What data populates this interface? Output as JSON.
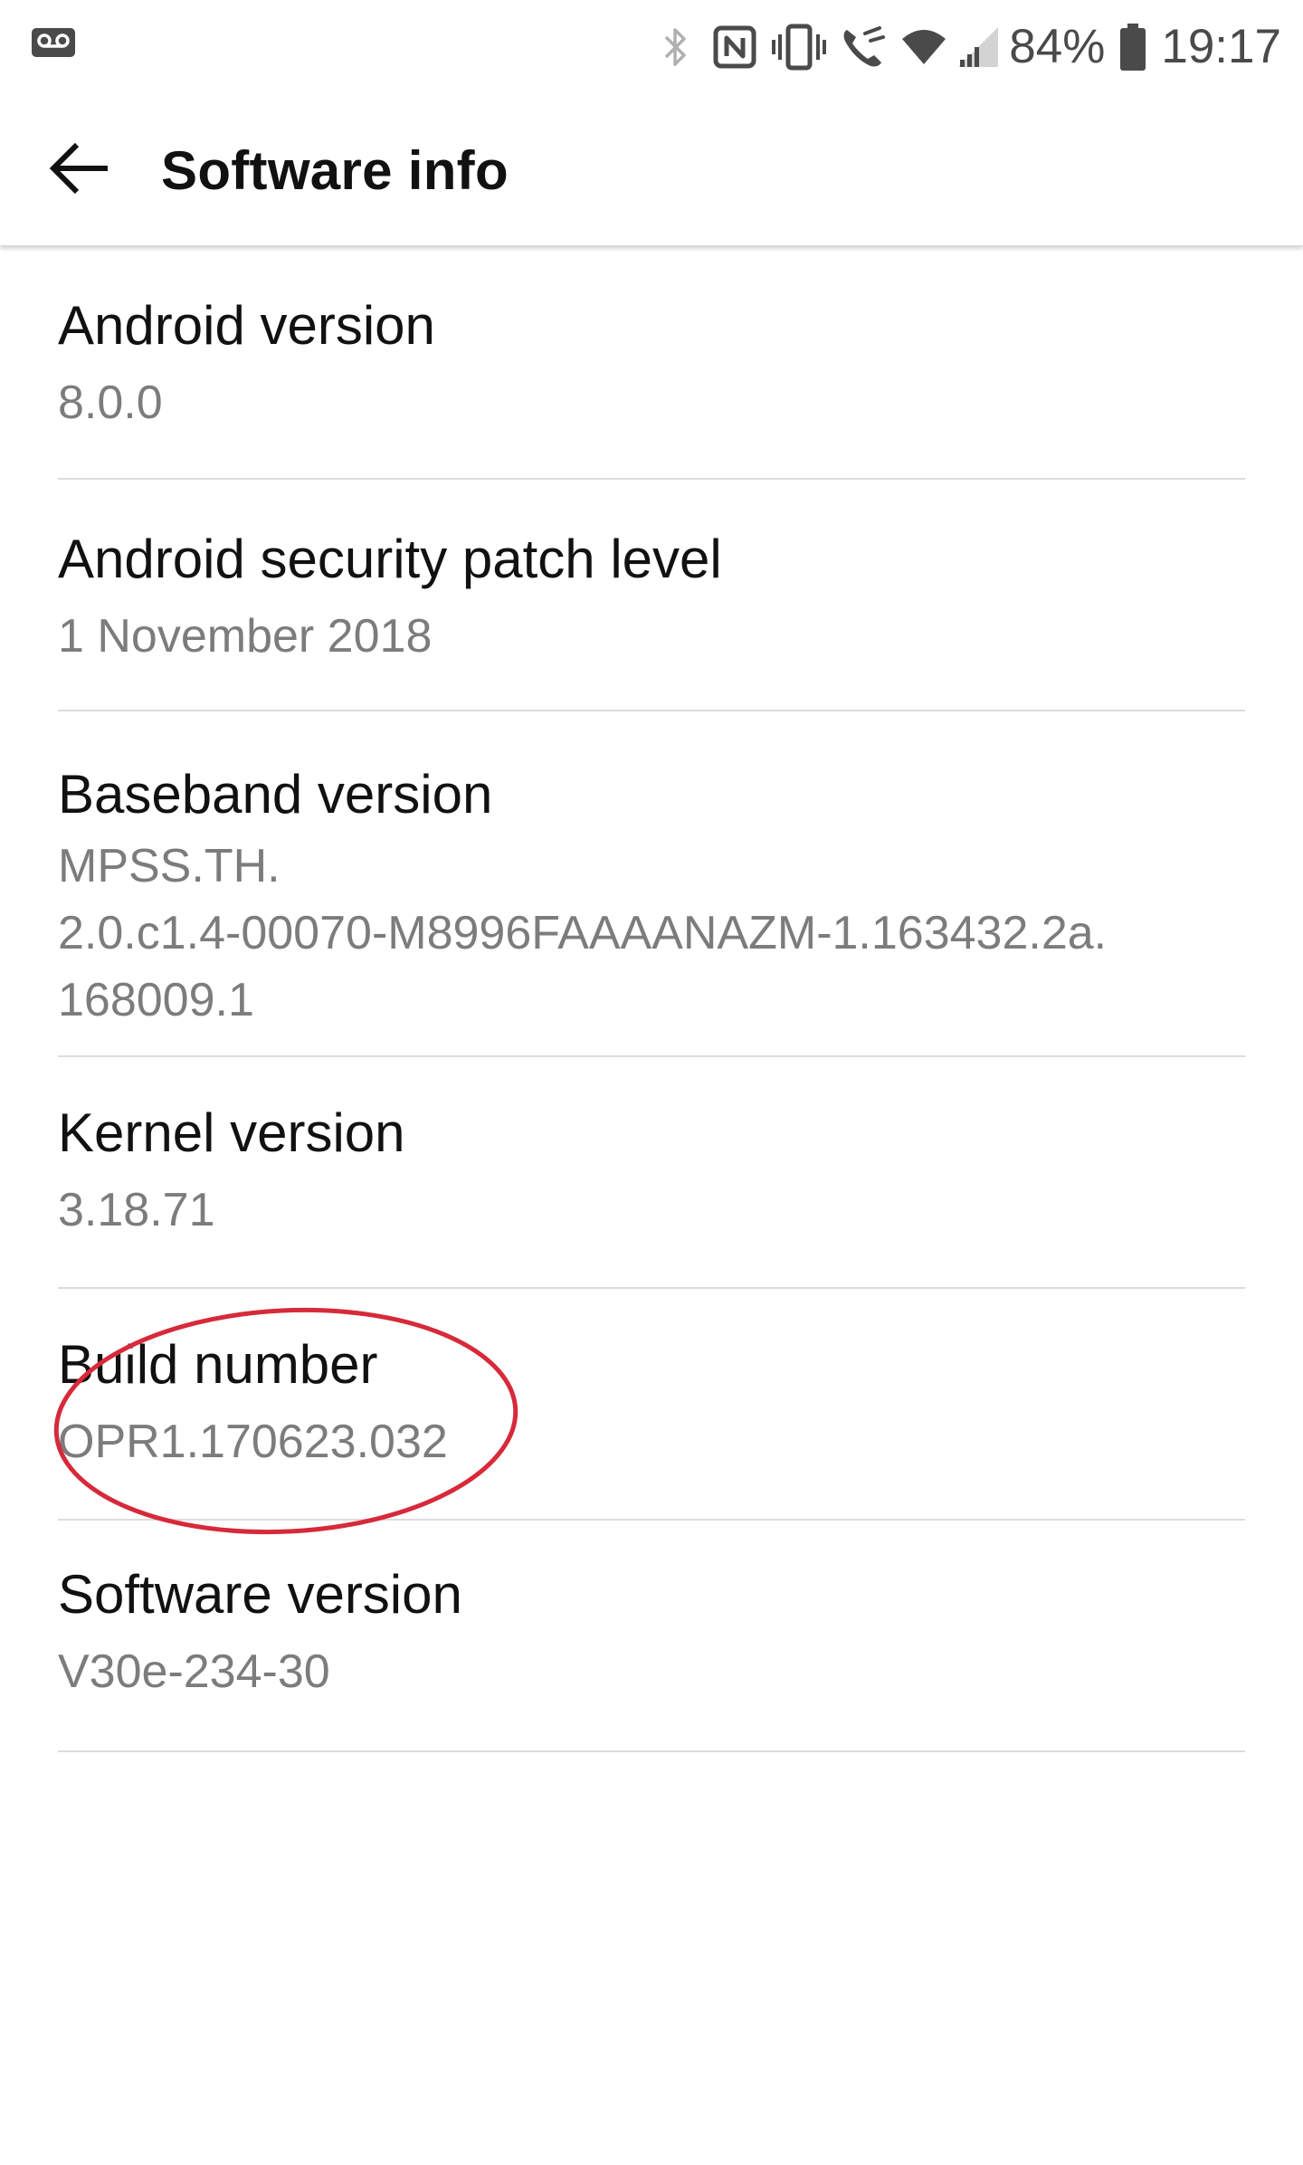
{
  "status_bar": {
    "left_icons": [
      "voicemail-icon"
    ],
    "right_icons": [
      "bluetooth-icon",
      "nfc-icon",
      "vibrate-icon",
      "wifi-calling-icon",
      "wifi-icon",
      "cell-signal-icon"
    ],
    "battery_percent": "84%",
    "battery_icon": "battery-icon",
    "time": "19:17"
  },
  "app_bar": {
    "back_icon": "arrow-back-icon",
    "title": "Software info"
  },
  "items": [
    {
      "title": "Android version",
      "value": "8.0.0"
    },
    {
      "title": "Android security patch level",
      "value": "1 November 2018"
    },
    {
      "title": "Baseband version",
      "value": "MPSS.TH.\n2.0.c1.4-00070-M8996FAAAANAZM-1.163432.2a.\n168009.1"
    },
    {
      "title": "Kernel version",
      "value": "3.18.71"
    },
    {
      "title": "Build number",
      "value": "OPR1.170623.032"
    },
    {
      "title": "Software version",
      "value": "V30e-234-30"
    }
  ],
  "colors": {
    "title_text": "#111111",
    "value_text": "#7c7c7c",
    "divider": "#dcdcdc",
    "status_icons": "#4a4a4a",
    "annotation": "#d62a3a"
  },
  "annotation": {
    "shape": "ellipse",
    "highlights": "Build number"
  }
}
